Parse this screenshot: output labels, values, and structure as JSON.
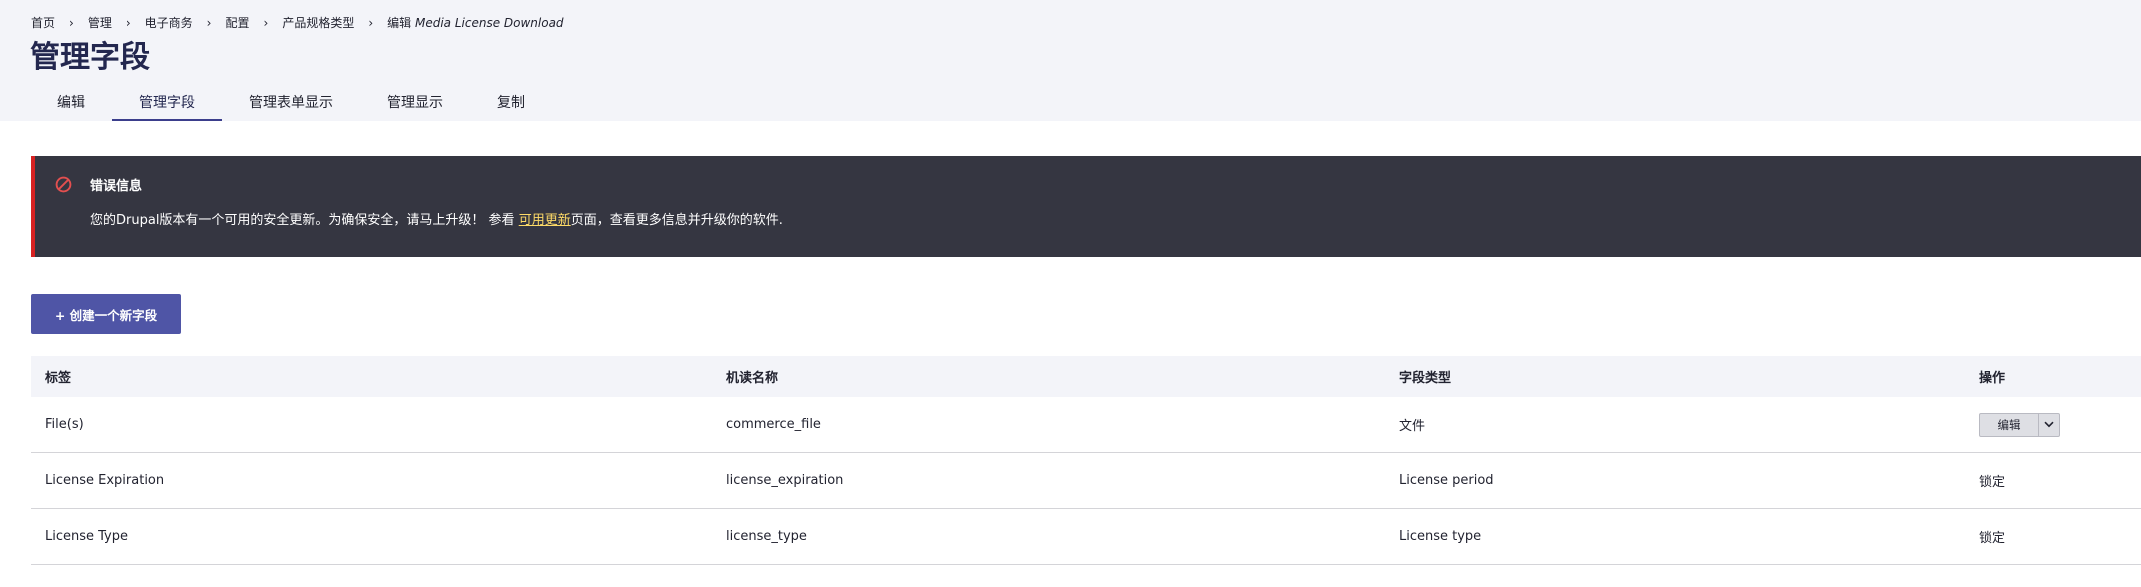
{
  "breadcrumb": [
    {
      "label": "首页"
    },
    {
      "label": "管理"
    },
    {
      "label": "电子商务"
    },
    {
      "label": "配置"
    },
    {
      "label": "产品规格类型"
    }
  ],
  "breadcrumb_current": {
    "prefix": "编辑",
    "name": "Media License Download"
  },
  "page_title": "管理字段",
  "tabs": [
    {
      "label": "编辑"
    },
    {
      "label": "管理字段",
      "active": true
    },
    {
      "label": "管理表单显示"
    },
    {
      "label": "管理显示"
    },
    {
      "label": "复制"
    }
  ],
  "message": {
    "title": "错误信息",
    "text_before": "您的Drupal版本有一个可用的安全更新。为确保安全，请马上升级！ 参看 ",
    "link": "可用更新",
    "text_after": "页面，查看更多信息并升级你的软件."
  },
  "add_button": "+ 创建一个新字段",
  "table": {
    "headers": [
      "标签",
      "机读名称",
      "字段类型",
      "操作"
    ],
    "rows": [
      {
        "label": "File(s)",
        "machine_name": "commerce_file",
        "type": "文件",
        "op": "编辑",
        "op_dropdown": true
      },
      {
        "label": "License Expiration",
        "machine_name": "license_expiration",
        "type": "License period",
        "op": "锁定",
        "op_dropdown": false
      },
      {
        "label": "License Type",
        "machine_name": "license_type",
        "type": "License type",
        "op": "锁定",
        "op_dropdown": false
      }
    ]
  },
  "colors": {
    "header_bg": "#f3f4f9",
    "title": "#23274f",
    "accent": "#4f55a6",
    "message_bg": "#353641",
    "error_red": "#d72222",
    "link_yellow": "#fedb67"
  },
  "icons": {
    "breadcrumb_separator": "chevron-right-icon",
    "message": "prohibited-icon",
    "dropdown": "chevron-down-icon"
  }
}
